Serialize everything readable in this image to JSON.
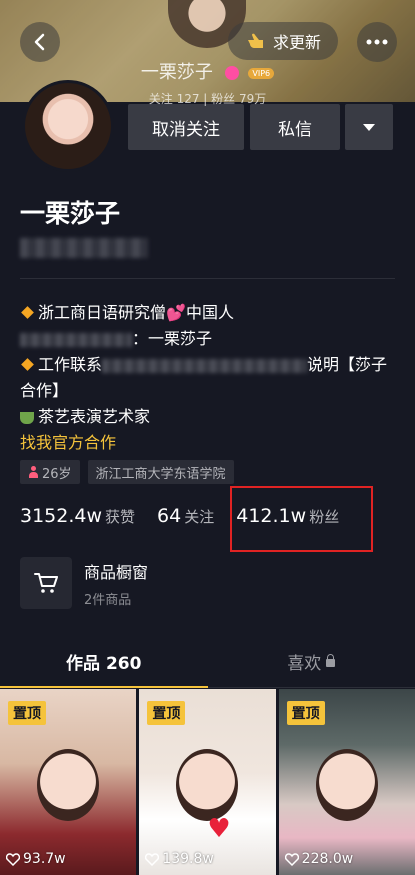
{
  "header": {
    "name": "一栗莎子",
    "vip_badge": "VIP6",
    "stats_line": "关注  127   |   粉丝  79万",
    "update_button": "求更新"
  },
  "actions": {
    "unfollow": "取消关注",
    "message": "私信"
  },
  "profile": {
    "name": "一栗莎子",
    "bio": {
      "line1": "浙工商日语研究僧",
      "line1b": "中国人",
      "line2_suffix": "：一栗莎子",
      "line3_prefix": "工作联系",
      "line3_suffix": "说明【莎子",
      "line4": "合作】",
      "line5": "茶艺表演艺术家",
      "official": "找我官方合作"
    },
    "tags": [
      "26岁",
      "浙江工商大学东语学院"
    ]
  },
  "stats": [
    {
      "value": "3152.4w",
      "label": "获赞"
    },
    {
      "value": "64",
      "label": "关注"
    },
    {
      "value": "412.1w",
      "label": "粉丝"
    }
  ],
  "shop": {
    "title": "商品橱窗",
    "subtitle": "2件商品"
  },
  "tabs": {
    "works": "作品 260",
    "likes": "喜欢"
  },
  "videos": [
    {
      "pinned": "置顶",
      "likes": "93.7w"
    },
    {
      "pinned": "置顶",
      "likes": "139.8w"
    },
    {
      "pinned": "置顶",
      "likes": "228.0w"
    }
  ],
  "colors": {
    "background": "#161823",
    "accent": "#f5c33b",
    "highlight": "#e02323"
  }
}
